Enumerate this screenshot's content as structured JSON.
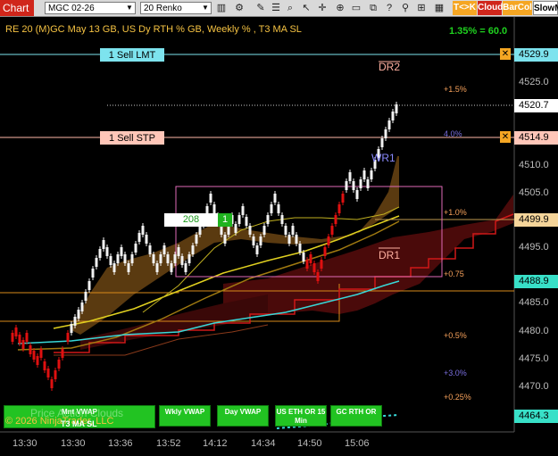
{
  "toolbar": {
    "title": "Chart",
    "instrument": "MGC 02-26",
    "bar_type": "20 Renko",
    "btn_tk": "T<>K",
    "btn_cloud": "Cloud",
    "btn_barcol": "BarCol",
    "btn_slowm": "SlowM",
    "icons": [
      "search-icon",
      "list-icon",
      "bar-chart-icon",
      "properties-icon",
      "pen-icon",
      "zoom-icon",
      "rect-icon",
      "cursor-icon",
      "crosshair-icon",
      "magnify-icon",
      "template-icon",
      "help-icon",
      "grid-icon"
    ]
  },
  "header": {
    "title": "RE 20  (M)GC May 13 GB, US Dy RTH % GB, Weekly % , T3 MA SL",
    "right_value": "1.35% = 60.0"
  },
  "orders": {
    "sell_lmt": "1 Sell LMT",
    "sell_stp": "1 Sell STP",
    "qty_box": "208",
    "qty_num": "1"
  },
  "annotations": {
    "dr2": "DR2",
    "wr1": "WR1",
    "dr1": "DR1"
  },
  "pct_labels": [
    {
      "text": "+1.5%",
      "color": "#f5a05a"
    },
    {
      "text": "4.0%",
      "color": "#7a6fe0"
    },
    {
      "text": "+1.0%",
      "color": "#f5a05a"
    },
    {
      "text": "+0.75",
      "color": "#f5a05a"
    },
    {
      "text": "+0.5%",
      "color": "#f5a05a"
    },
    {
      "text": "+3.0%",
      "color": "#7a6fe0"
    },
    {
      "text": "+0.25%",
      "color": "#f5a05a"
    }
  ],
  "price_labels": [
    {
      "text": "4529.9",
      "bg": "#7de3ee",
      "fg": "#000"
    },
    {
      "text": "4525.0",
      "bg": "",
      "fg": "#bbb"
    },
    {
      "text": "4520.7",
      "bg": "#ffffff",
      "fg": "#000"
    },
    {
      "text": "4514.9",
      "bg": "#ffc6b8",
      "fg": "#000"
    },
    {
      "text": "4510.0",
      "bg": "",
      "fg": "#bbb"
    },
    {
      "text": "4505.0",
      "bg": "",
      "fg": "#bbb"
    },
    {
      "text": "4499.9",
      "bg": "#f5d59a",
      "fg": "#000"
    },
    {
      "text": "4495.0",
      "bg": "",
      "fg": "#bbb"
    },
    {
      "text": "4488.9",
      "bg": "#38e0c8",
      "fg": "#000"
    },
    {
      "text": "4485.0",
      "bg": "",
      "fg": "#bbb"
    },
    {
      "text": "4480.0",
      "bg": "",
      "fg": "#bbb"
    },
    {
      "text": "4475.0",
      "bg": "",
      "fg": "#bbb"
    },
    {
      "text": "4470.0",
      "bg": "",
      "fg": "#bbb"
    },
    {
      "text": "4464.3",
      "bg": "#38e0c8",
      "fg": "#000"
    }
  ],
  "time_labels": [
    "13:30",
    "13:30",
    "13:36",
    "13:52",
    "14:12",
    "14:34",
    "14:50",
    "15:06"
  ],
  "buttons": {
    "mnt_vwap": "Mnt VWAP",
    "wkly_vwap": "Wkly VWAP",
    "day_vwap": "Day VWAP",
    "us_eth": "US ETH OR 15 Min",
    "gc_rth": "GC RTH OR",
    "t3_ma": "T3 MA SL"
  },
  "watermark": {
    "line1": "Price Action Clouds",
    "line2": "© 2026 NinjaTrader, LLC"
  },
  "colors": {
    "accent_red": "#d0261b",
    "cloud_green": "#22c322",
    "orange": "#f5a623",
    "cyan": "#38e0c8"
  }
}
